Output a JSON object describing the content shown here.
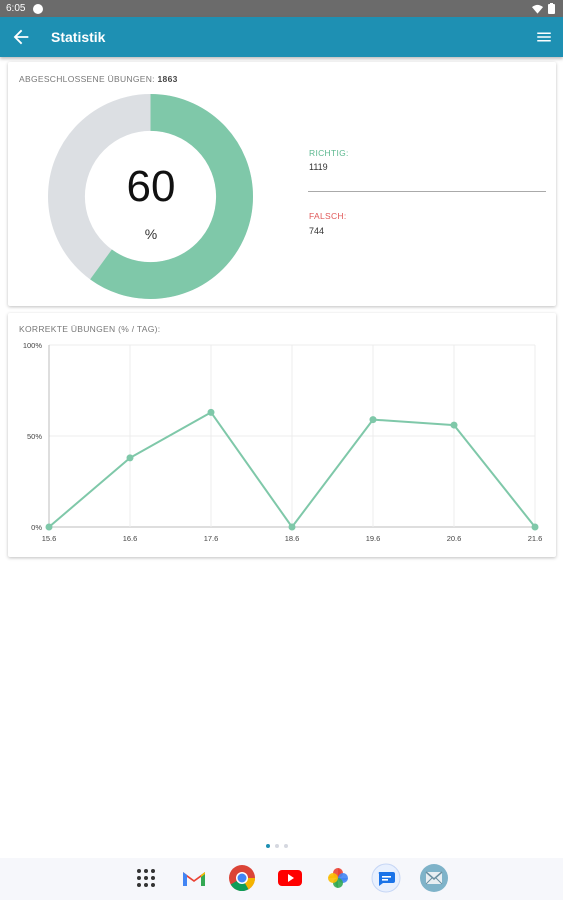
{
  "status_bar": {
    "time": "6:05"
  },
  "app_bar": {
    "title": "Statistik"
  },
  "summary": {
    "completed_label": "ABGESCHLOSSENE ÜBUNGEN:",
    "completed_count": "1863",
    "percent_value": "60",
    "percent_sign": "%",
    "correct_label": "RICHTIG:",
    "correct_value": "1119",
    "wrong_label": "FALSCH:",
    "wrong_value": "744",
    "colors": {
      "correct": "#7fc8a9",
      "wrong": "#dcdfe3",
      "correct_text": "#5cb88f",
      "wrong_text": "#e05858"
    }
  },
  "chart_data": {
    "type": "line",
    "title": "KORREKTE ÜBUNGEN (% / Tag):",
    "categories": [
      "15.6",
      "16.6",
      "17.6",
      "18.6",
      "19.6",
      "20.6",
      "21.6"
    ],
    "series": [
      {
        "values": [
          0,
          38,
          63,
          0,
          59,
          56,
          0
        ]
      }
    ],
    "ylim": [
      0,
      100
    ],
    "yticks": [
      "0%",
      "50%",
      "100%"
    ],
    "grid": true,
    "color": "#7fc8a9"
  },
  "pager": {
    "pages": 3,
    "active": 0
  },
  "dock": {
    "apps": [
      "apps-icon",
      "gmail-icon",
      "chrome-icon",
      "youtube-icon",
      "photos-icon",
      "messages-icon",
      "mail-app-icon"
    ]
  }
}
